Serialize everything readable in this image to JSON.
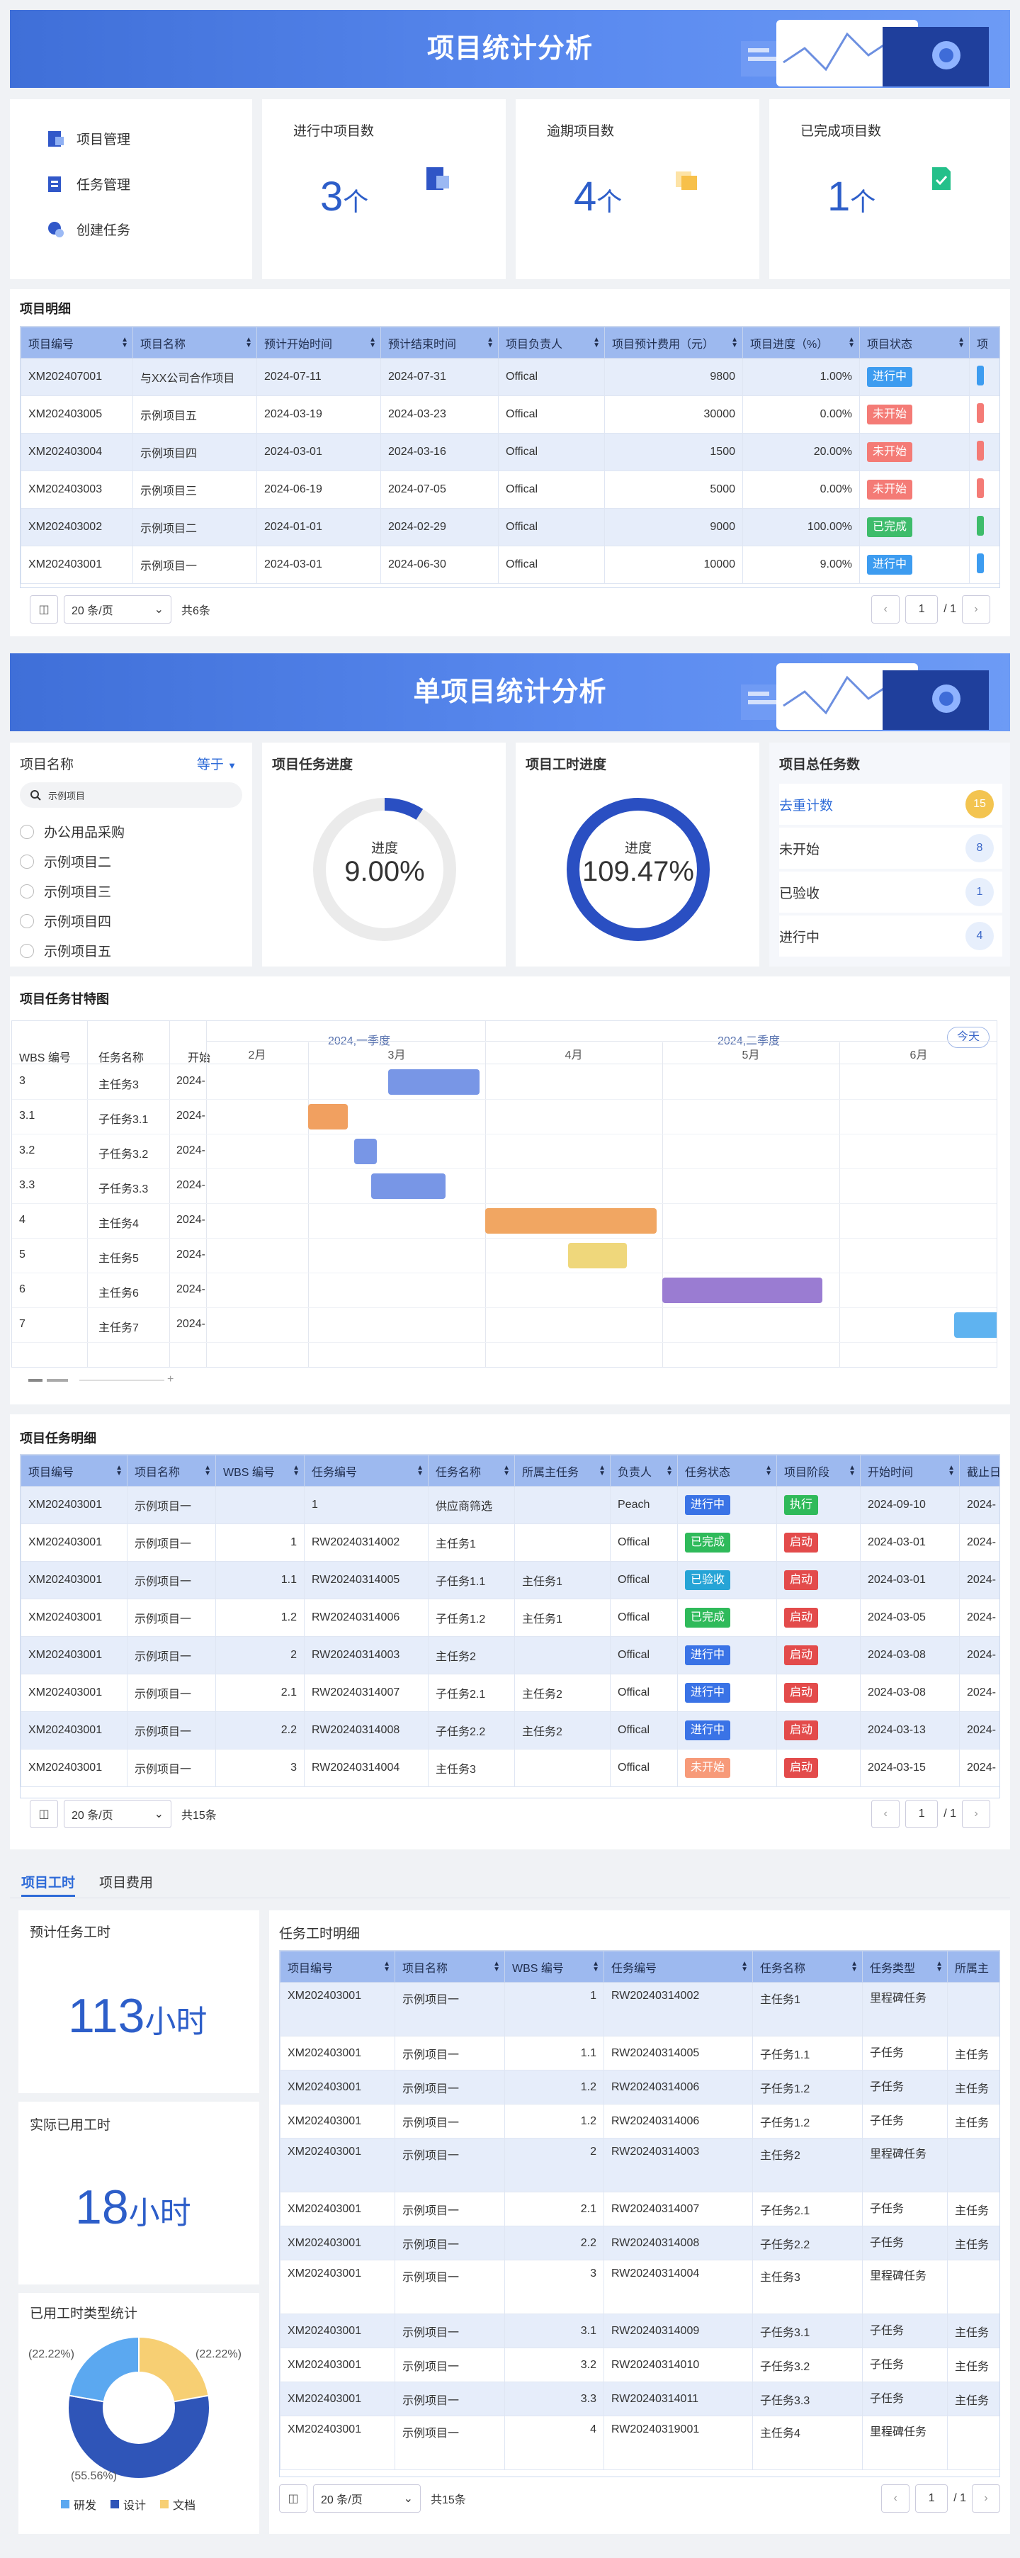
{
  "banner1": {
    "title": "项目统计分析"
  },
  "banner2": {
    "title": "单项目统计分析"
  },
  "menu": {
    "items": [
      {
        "label": "项目管理",
        "icon": "project-icon"
      },
      {
        "label": "任务管理",
        "icon": "task-icon"
      },
      {
        "label": "创建任务",
        "icon": "create-icon"
      }
    ]
  },
  "stats": [
    {
      "title": "进行中项目数",
      "value": "3",
      "unit": "个"
    },
    {
      "title": "逾期项目数",
      "value": "4",
      "unit": "个"
    },
    {
      "title": "已完成项目数",
      "value": "1",
      "unit": "个"
    }
  ],
  "projects": {
    "title": "项目明细",
    "headers": [
      "项目编号",
      "项目名称",
      "预计开始时间",
      "预计结束时间",
      "项目负责人",
      "项目预计费用（元）",
      "项目进度（%）",
      "项目状态",
      "项"
    ],
    "rows": [
      [
        "XM202407001",
        "与XX公司合作项目",
        "2024-07-11",
        "2024-07-31",
        "Offical",
        "9800",
        "1.00%",
        "进行中"
      ],
      [
        "XM202403005",
        "示例项目五",
        "2024-03-19",
        "2024-03-23",
        "Offical",
        "30000",
        "0.00%",
        "未开始"
      ],
      [
        "XM202403004",
        "示例项目四",
        "2024-03-01",
        "2024-03-16",
        "Offical",
        "1500",
        "20.00%",
        "未开始"
      ],
      [
        "XM202403003",
        "示例项目三",
        "2024-06-19",
        "2024-07-05",
        "Offical",
        "5000",
        "0.00%",
        "未开始"
      ],
      [
        "XM202403002",
        "示例项目二",
        "2024-01-01",
        "2024-02-29",
        "Offical",
        "9000",
        "100.00%",
        "已完成"
      ],
      [
        "XM202403001",
        "示例项目一",
        "2024-03-01",
        "2024-06-30",
        "Offical",
        "10000",
        "9.00%",
        "进行中"
      ]
    ],
    "page_size": "20 条/页",
    "total": "共6条",
    "page": "1",
    "pages": "/ 1"
  },
  "single": {
    "filter_label": "项目名称",
    "filter_op": "等于",
    "search_value": "示例项目",
    "options": [
      "办公用品采购",
      "示例项目二",
      "示例项目三",
      "示例项目四",
      "示例项目五"
    ],
    "task_progress": {
      "title": "项目任务进度",
      "label": "进度",
      "value": "9.00%",
      "ratio": 0.09
    },
    "hour_progress": {
      "title": "项目工时进度",
      "label": "进度",
      "value": "109.47%",
      "ratio": 1.0
    },
    "task_count": {
      "title": "项目总任务数",
      "rows": [
        {
          "label": "去重计数",
          "value": "15"
        },
        {
          "label": "未开始",
          "value": "8"
        },
        {
          "label": "已验收",
          "value": "1"
        },
        {
          "label": "进行中",
          "value": "4"
        }
      ]
    }
  },
  "gantt": {
    "title": "项目任务甘特图",
    "col_wbs": "WBS 编号",
    "col_name": "任务名称",
    "col_start": "开始",
    "quarters": [
      "2024,一季度",
      "2024,二季度"
    ],
    "today": "今天",
    "months": [
      "2月",
      "3月",
      "4月",
      "5月",
      "6月"
    ],
    "rows": [
      {
        "wbs": "3",
        "name": "主任务3",
        "start": "2024-"
      },
      {
        "wbs": "3.1",
        "name": "子任务3.1",
        "start": "2024-"
      },
      {
        "wbs": "3.2",
        "name": "子任务3.2",
        "start": "2024-"
      },
      {
        "wbs": "3.3",
        "name": "子任务3.3",
        "start": "2024-"
      },
      {
        "wbs": "4",
        "name": "主任务4",
        "start": "2024-"
      },
      {
        "wbs": "5",
        "name": "主任务5",
        "start": "2024-"
      },
      {
        "wbs": "6",
        "name": "主任务6",
        "start": "2024-"
      },
      {
        "wbs": "7",
        "name": "主任务7",
        "start": "2024-"
      }
    ],
    "bar_colors": [
      "#7896e6",
      "#f1a060",
      "#7896e6",
      "#7896e6",
      "#f1a662",
      "#efd77b",
      "#9a7cd2",
      "#5fb3f0"
    ]
  },
  "tasks": {
    "title": "项目任务明细",
    "headers": [
      "项目编号",
      "项目名称",
      "WBS 编号",
      "任务编号",
      "任务名称",
      "所属主任务",
      "负责人",
      "任务状态",
      "项目阶段",
      "开始时间",
      "截止日"
    ],
    "rows": [
      [
        "XM202403001",
        "示例项目一",
        "",
        "1",
        "供应商筛选",
        "",
        "Peach",
        "进行中",
        "执行",
        "2024-09-10",
        "2024-"
      ],
      [
        "XM202403001",
        "示例项目一",
        "1",
        "RW20240314002",
        "主任务1",
        "",
        "Offical",
        "已完成",
        "启动",
        "2024-03-01",
        "2024-"
      ],
      [
        "XM202403001",
        "示例项目一",
        "1.1",
        "RW20240314005",
        "子任务1.1",
        "主任务1",
        "Offical",
        "已验收",
        "启动",
        "2024-03-01",
        "2024-"
      ],
      [
        "XM202403001",
        "示例项目一",
        "1.2",
        "RW20240314006",
        "子任务1.2",
        "主任务1",
        "Offical",
        "已完成",
        "启动",
        "2024-03-05",
        "2024-"
      ],
      [
        "XM202403001",
        "示例项目一",
        "2",
        "RW20240314003",
        "主任务2",
        "",
        "Offical",
        "进行中",
        "启动",
        "2024-03-08",
        "2024-"
      ],
      [
        "XM202403001",
        "示例项目一",
        "2.1",
        "RW20240314007",
        "子任务2.1",
        "主任务2",
        "Offical",
        "进行中",
        "启动",
        "2024-03-08",
        "2024-"
      ],
      [
        "XM202403001",
        "示例项目一",
        "2.2",
        "RW20240314008",
        "子任务2.2",
        "主任务2",
        "Offical",
        "进行中",
        "启动",
        "2024-03-13",
        "2024-"
      ],
      [
        "XM202403001",
        "示例项目一",
        "3",
        "RW20240314004",
        "主任务3",
        "",
        "Offical",
        "未开始",
        "启动",
        "2024-03-15",
        "2024-"
      ]
    ],
    "page_size": "20 条/页",
    "total": "共15条",
    "page": "1",
    "pages": "/ 1"
  },
  "tabs": [
    "项目工时",
    "项目费用"
  ],
  "hours": {
    "planned_title": "预计任务工时",
    "planned_value": "113",
    "planned_unit": "小时",
    "used_title": "实际已用工时",
    "used_value": "18",
    "used_unit": "小时"
  },
  "pie": {
    "title": "已用工时类型统计",
    "labels": [
      "(22.22%)",
      "(22.22%)",
      "(55.56%)"
    ],
    "legend": [
      "研发",
      "设计",
      "文档"
    ],
    "colors": [
      "#5ba8f0",
      "#2f55b8",
      "#f7cf73"
    ],
    "values": [
      22.22,
      55.56,
      22.22
    ]
  },
  "hour_detail": {
    "title": "任务工时明细",
    "headers": [
      "项目编号",
      "项目名称",
      "WBS 编号",
      "任务编号",
      "任务名称",
      "任务类型",
      "所属主"
    ],
    "rows": [
      [
        "XM202403001",
        "示例项目一",
        "1",
        "RW20240314002",
        "主任务1",
        "里程碑任务",
        ""
      ],
      [
        "XM202403001",
        "示例项目一",
        "1.1",
        "RW20240314005",
        "子任务1.1",
        "子任务",
        "主任务"
      ],
      [
        "XM202403001",
        "示例项目一",
        "1.2",
        "RW20240314006",
        "子任务1.2",
        "子任务",
        "主任务"
      ],
      [
        "XM202403001",
        "示例项目一",
        "1.2",
        "RW20240314006",
        "子任务1.2",
        "子任务",
        "主任务"
      ],
      [
        "XM202403001",
        "示例项目一",
        "2",
        "RW20240314003",
        "主任务2",
        "里程碑任务",
        ""
      ],
      [
        "XM202403001",
        "示例项目一",
        "2.1",
        "RW20240314007",
        "子任务2.1",
        "子任务",
        "主任务"
      ],
      [
        "XM202403001",
        "示例项目一",
        "2.2",
        "RW20240314008",
        "子任务2.2",
        "子任务",
        "主任务"
      ],
      [
        "XM202403001",
        "示例项目一",
        "3",
        "RW20240314004",
        "主任务3",
        "里程碑任务",
        ""
      ],
      [
        "XM202403001",
        "示例项目一",
        "3.1",
        "RW20240314009",
        "子任务3.1",
        "子任务",
        "主任务"
      ],
      [
        "XM202403001",
        "示例项目一",
        "3.2",
        "RW20240314010",
        "子任务3.2",
        "子任务",
        "主任务"
      ],
      [
        "XM202403001",
        "示例项目一",
        "3.3",
        "RW20240314011",
        "子任务3.3",
        "子任务",
        "主任务"
      ],
      [
        "XM202403001",
        "示例项目一",
        "4",
        "RW20240319001",
        "主任务4",
        "里程碑任务",
        ""
      ]
    ],
    "page_size": "20 条/页",
    "total": "共15条",
    "page": "1",
    "pages": "/ 1"
  }
}
